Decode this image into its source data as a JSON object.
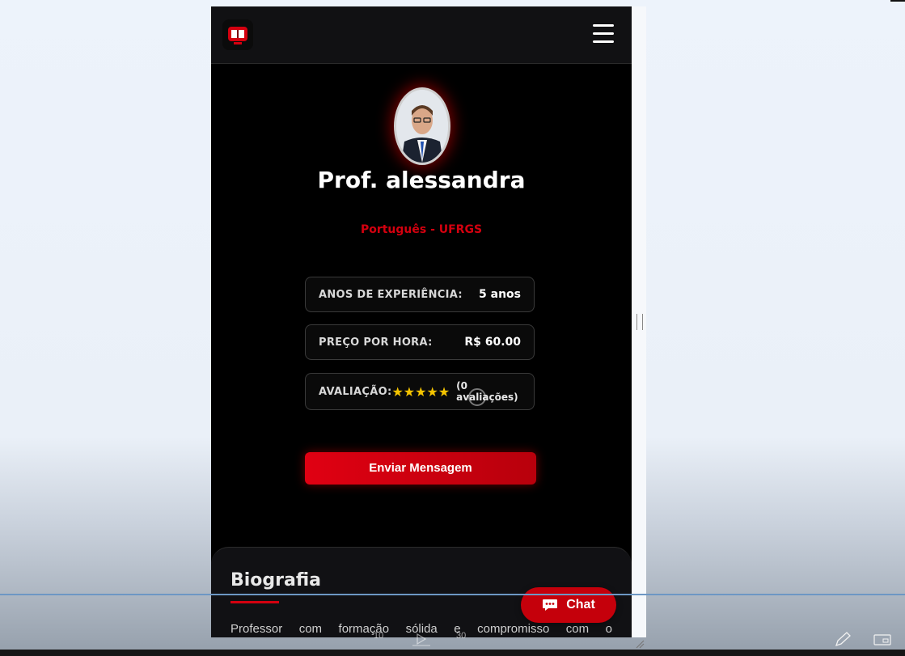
{
  "colors": {
    "accent": "#d4000f",
    "background": "#000000",
    "star": "#f5c400"
  },
  "header": {
    "logo_icon": "book-icon",
    "menu_icon": "hamburger-icon"
  },
  "profile": {
    "name": "Prof. alessandra",
    "subject": "Português - UFRGS",
    "info": [
      {
        "label": "ANOS DE EXPERIÊNCIA:",
        "value": "5 anos"
      },
      {
        "label": "PREÇO POR HORA:",
        "value": "R$ 60.00"
      },
      {
        "label": "AVALIAÇÃO:",
        "stars": "★★★★★",
        "value": "(0 avaliações)"
      }
    ],
    "send_button": "Enviar Mensagem"
  },
  "bio": {
    "title": "Biografia",
    "text": "Professor com formação sólida e compromisso com o"
  },
  "chat": {
    "label": "Chat",
    "icon": "chat-bubble-icon"
  },
  "media": {
    "rewind": "10",
    "forward": "30"
  }
}
